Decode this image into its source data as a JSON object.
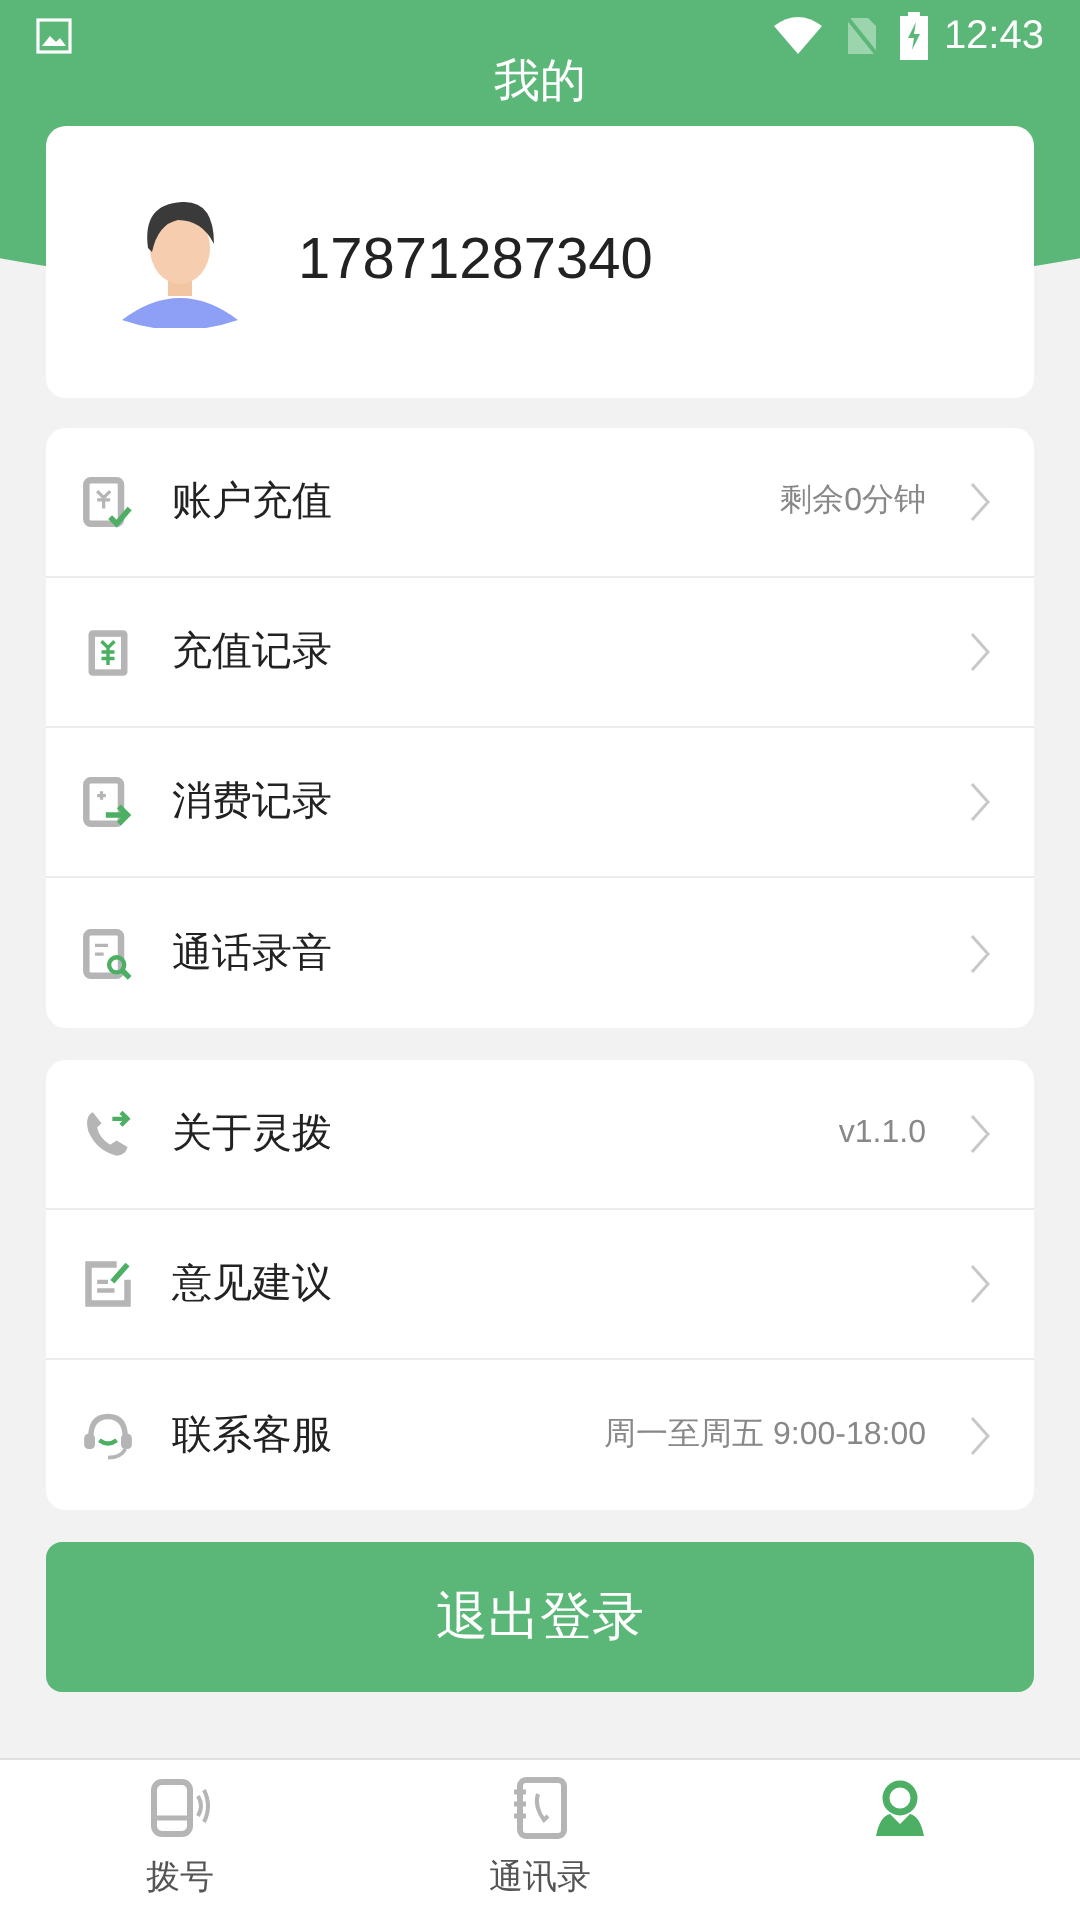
{
  "status_bar": {
    "time": "12:43"
  },
  "header": {
    "title": "我的"
  },
  "profile": {
    "phone": "17871287340"
  },
  "menu_groups": [
    {
      "items": [
        {
          "label": "账户充值",
          "value": "剩余0分钟"
        },
        {
          "label": "充值记录"
        },
        {
          "label": "消费记录"
        },
        {
          "label": "通话录音"
        }
      ]
    },
    {
      "items": [
        {
          "label": "关于灵拨",
          "value": "v1.1.0"
        },
        {
          "label": "意见建议"
        },
        {
          "label": "联系客服",
          "value": "周一至周五 9:00-18:00"
        }
      ]
    }
  ],
  "logout_button": "退出登录",
  "tab_bar": [
    {
      "label": "拨号",
      "selected": false
    },
    {
      "label": "通讯录",
      "selected": false
    },
    {
      "selected": true
    }
  ]
}
